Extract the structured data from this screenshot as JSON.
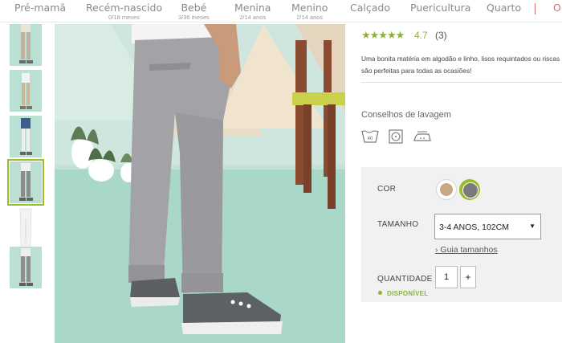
{
  "nav": [
    {
      "label": "Pré-mamã",
      "sub": ""
    },
    {
      "label": "Recém-nascido",
      "sub": "0/18 meses"
    },
    {
      "label": "Bebé",
      "sub": "3/36 meses"
    },
    {
      "label": "Menina",
      "sub": "2/14 anos"
    },
    {
      "label": "Menino",
      "sub": "2/14 anos"
    },
    {
      "label": "Calçado",
      "sub": ""
    },
    {
      "label": "Puericultura",
      "sub": ""
    },
    {
      "label": "Quarto",
      "sub": ""
    },
    {
      "label": "O",
      "sub": ""
    }
  ],
  "product": {
    "stars": "★★★★★",
    "rating": "4.7",
    "review_count": "(3)",
    "description": "Uma bonita matéria em algodão e linho, lisos requintados ou riscas são perfeitas para todas as ocasiões!",
    "description_lines": [
      "Uma bonita matéria em algodão e linho, lisos requintados ou riscas",
      "são perfeitas para todas as ocasiões!"
    ],
    "wash_title": "Conselhos de lavagem",
    "wash_icons": [
      "wash-40-icon",
      "tumble-dry-icon",
      "iron-icon"
    ],
    "wash_temp": "40"
  },
  "options": {
    "color_label": "COR",
    "colors": [
      {
        "name": "beige",
        "hex": "#c9a88a",
        "selected": false
      },
      {
        "name": "grey",
        "hex": "#7a7a7a",
        "selected": true
      }
    ],
    "size_label": "TAMANHO",
    "size_value": "3-4 ANOS, 102CM",
    "size_guide": "› Guia tamanhos",
    "qty_label": "QUANTIDADE",
    "qty_value": "1",
    "qty_plus": "+",
    "availability": "DISPONÍVEL"
  },
  "colors": {
    "accent_green": "#8fb338",
    "selected_outline": "#9cbb2e",
    "floor_mint": "#a9d8c8"
  }
}
